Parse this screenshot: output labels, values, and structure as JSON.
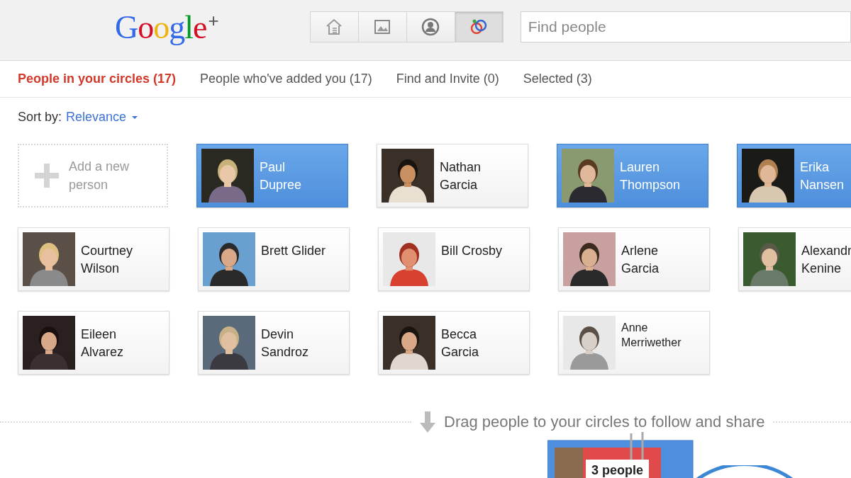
{
  "header": {
    "logo": "Google$^{+}$",
    "nav": [
      {
        "kind": "home",
        "selected": false
      },
      {
        "kind": "photos",
        "selected": false
      },
      {
        "kind": "profile",
        "selected": false
      },
      {
        "kind": "circles",
        "selected": true
      }
    ],
    "search": {
      "placeholder": "Find people"
    }
  },
  "tabs": [
    {
      "label": "People in your circles (17)",
      "selected": true
    },
    {
      "label": "People who've added you (17)",
      "selected": false
    },
    {
      "label": "Find and Invite (0)",
      "selected": false
    },
    {
      "label": "Selected (3)",
      "selected": false
    }
  ],
  "sort": {
    "label": "Sort by:",
    "value": "Relevance"
  },
  "add_card": {
    "label": "Add a new person"
  },
  "people": [
    {
      "name_lines": [
        "Paul",
        "Dupree"
      ],
      "selected": true
    },
    {
      "name_lines": [
        "Nathan",
        "Garcia"
      ],
      "selected": false
    },
    {
      "name_lines": [
        "Lauren",
        "Thompson"
      ],
      "selected": true
    },
    {
      "name_lines": [
        "Erika",
        "Nansen"
      ],
      "selected": true
    },
    {
      "name_lines": [
        "Courtney",
        "Wilson"
      ],
      "selected": false
    },
    {
      "name_lines": [
        "Brett Glider"
      ],
      "selected": false
    },
    {
      "name_lines": [
        "Bill Crosby"
      ],
      "selected": false
    },
    {
      "name_lines": [
        "Arlene",
        "Garcia"
      ],
      "selected": false
    },
    {
      "name_lines": [
        "Alexandr",
        "Kenine"
      ],
      "selected": false
    },
    {
      "name_lines": [
        "Eileen",
        "Alvarez"
      ],
      "selected": false
    },
    {
      "name_lines": [
        "Devin",
        "Sandroz"
      ],
      "selected": false
    },
    {
      "name_lines": [
        "Becca",
        "Garcia"
      ],
      "selected": false
    },
    {
      "name_lines": [
        "Anne",
        "Merriwether"
      ],
      "selected": false
    }
  ],
  "drop_hint": "Drag people to your circles to follow and share",
  "stack": {
    "label": "3 people"
  }
}
